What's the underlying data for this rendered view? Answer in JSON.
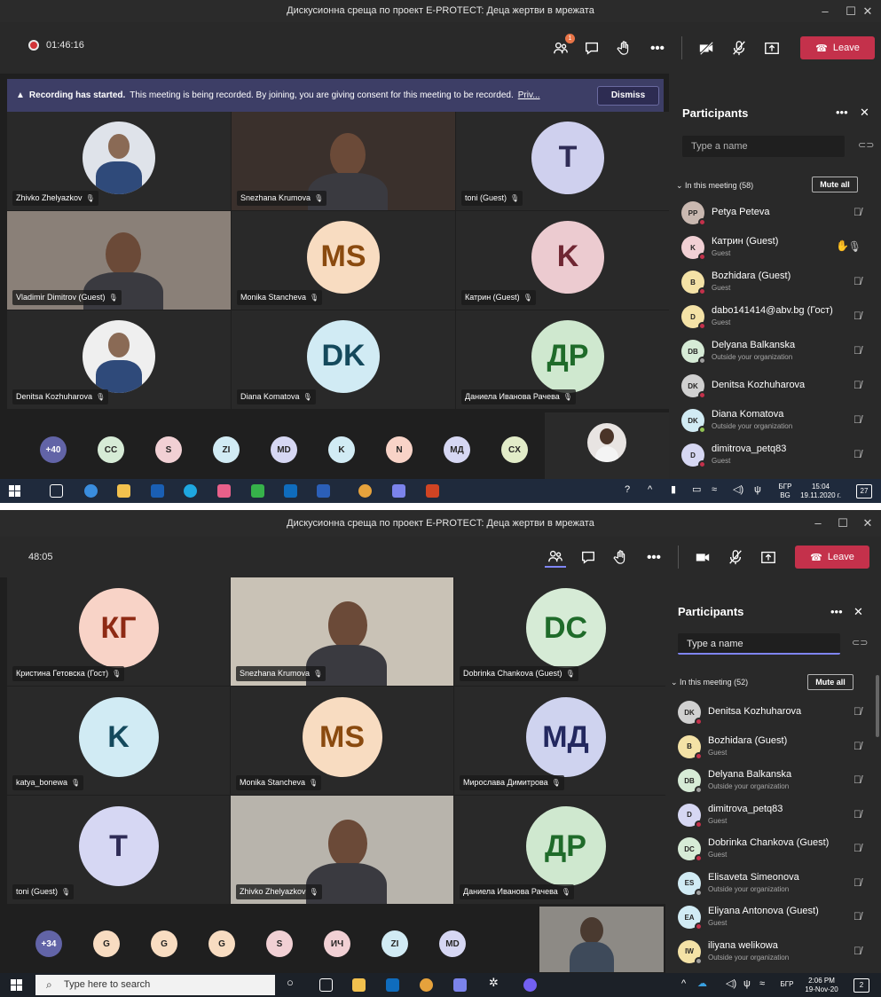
{
  "top": {
    "title": "Дискусионна среща по проект E-PROTECT: Деца жертви в мрежата",
    "timer": "01:46:16",
    "leave_label": "Leave",
    "participants_badge": "1",
    "banner": {
      "bold": "Recording has started.",
      "text": "This meeting is being recorded. By joining, you are giving consent for this meeting to be recorded.",
      "link": "Priv...",
      "dismiss": "Dismiss"
    },
    "tiles": [
      {
        "name": "Zhivko Zhelyazkov",
        "kind": "photo",
        "bg": "#dfe3ea"
      },
      {
        "name": "Snezhana Krumova",
        "kind": "video",
        "bg": "#3a302c"
      },
      {
        "name": "toni (Guest)",
        "initials": "T",
        "color": "#cfd0ee",
        "text": "#2f2c56"
      },
      {
        "name": "Vladimir Dimitrov (Guest)",
        "kind": "video",
        "bg": "#8a8078"
      },
      {
        "name": "Monika Stancheva",
        "initials": "MS",
        "color": "#f8dcc1",
        "text": "#8a4a0f"
      },
      {
        "name": "Катрин (Guest)",
        "initials": "K",
        "color": "#eccbd0",
        "text": "#6f2632"
      },
      {
        "name": "Denitsa Kozhuharova",
        "kind": "photo",
        "bg": "#efefef"
      },
      {
        "name": "Diana Komatova",
        "initials": "DK",
        "color": "#d1ebf4",
        "text": "#14495c"
      },
      {
        "name": "Даниела Иванова Рачева",
        "initials": "ДР",
        "color": "#cfe8cf",
        "text": "#1f6b2a"
      }
    ],
    "overflow": [
      {
        "label": "+40",
        "color": "#6264a7"
      },
      {
        "label": "CC",
        "color": "#d6ebd6"
      },
      {
        "label": "S",
        "color": "#f1d0d4"
      },
      {
        "label": "ZI",
        "color": "#d1ebf4"
      },
      {
        "label": "MD",
        "color": "#d6d7f3"
      },
      {
        "label": "K",
        "color": "#d1ebf4"
      },
      {
        "label": "N",
        "color": "#f8d3c7"
      },
      {
        "label": "МД",
        "color": "#d6d7f3"
      },
      {
        "label": "CX",
        "color": "#e2ecc8"
      }
    ],
    "panel": {
      "title": "Participants",
      "search_placeholder": "Type a name",
      "section": "In this meeting (58)",
      "mute_all": "Mute all",
      "people": [
        {
          "name": "Petya Peteva",
          "sub": "",
          "initials": "PP",
          "color": "#c9b8b0",
          "status": "#c4314b"
        },
        {
          "name": "Катрин (Guest)",
          "sub": "Guest",
          "initials": "K",
          "color": "#f1d0d4",
          "status": "#c4314b",
          "hand": true
        },
        {
          "name": "Bozhidara (Guest)",
          "sub": "Guest",
          "initials": "B",
          "color": "#f4e2a6",
          "status": "#c4314b"
        },
        {
          "name": "dabo141414@abv.bg (Гост)",
          "sub": "Guest",
          "initials": "D",
          "color": "#f4e2a6",
          "status": "#c4314b"
        },
        {
          "name": "Delyana Balkanska",
          "sub": "Outside your organization",
          "initials": "DB",
          "color": "#d6ebd6",
          "status": "#9e9e9e"
        },
        {
          "name": "Denitsa Kozhuharova",
          "sub": "",
          "initials": "DK",
          "color": "#d0d0d0",
          "status": "#c4314b"
        },
        {
          "name": "Diana Komatova",
          "sub": "Outside your organization",
          "initials": "DK",
          "color": "#d1ebf4",
          "status": "#92c353"
        },
        {
          "name": "dimitrova_petq83",
          "sub": "Guest",
          "initials": "D",
          "color": "#d6d7f3",
          "status": "#c4314b"
        }
      ]
    },
    "taskbar": {
      "lang1": "БГР",
      "lang2": "BG",
      "time": "15:04",
      "date": "19.11.2020 г.",
      "notif": "27"
    }
  },
  "bottom": {
    "title": "Дискусионна среща по проект E-PROTECT: Деца жертви в мрежата",
    "timer": "48:05",
    "leave_label": "Leave",
    "tiles": [
      {
        "name": "Кристина Гетовска (Гост)",
        "initials": "КГ",
        "color": "#f8d3c7",
        "text": "#8e2a14"
      },
      {
        "name": "Snezhana Krumova",
        "kind": "video",
        "bg": "#c9c2b6"
      },
      {
        "name": "Dobrinka Chankova (Guest)",
        "initials": "DC",
        "color": "#d6ebd6",
        "text": "#1f6b2a"
      },
      {
        "name": "katya_bonewa",
        "initials": "K",
        "color": "#d1ebf4",
        "text": "#14495c"
      },
      {
        "name": "Monika Stancheva",
        "initials": "MS",
        "color": "#f8dcc1",
        "text": "#8a4a0f"
      },
      {
        "name": "Мирослава Димитрова",
        "initials": "МД",
        "color": "#cfd3ef",
        "text": "#23285f"
      },
      {
        "name": "toni (Guest)",
        "initials": "T",
        "color": "#d6d7f3",
        "text": "#2f2c56"
      },
      {
        "name": "Zhivko Zhelyazkov",
        "kind": "video",
        "bg": "#b8b4ac"
      },
      {
        "name": "Даниела Иванова Рачева",
        "initials": "ДР",
        "color": "#cfe8cf",
        "text": "#1f6b2a"
      }
    ],
    "overflow": [
      {
        "label": "+34",
        "color": "#6264a7"
      },
      {
        "label": "G",
        "color": "#f8dcc1"
      },
      {
        "label": "G",
        "color": "#f8dcc1"
      },
      {
        "label": "G",
        "color": "#f8dcc1"
      },
      {
        "label": "S",
        "color": "#f1d0d4"
      },
      {
        "label": "ИЧ",
        "color": "#f1d0d4"
      },
      {
        "label": "ZI",
        "color": "#d1ebf4"
      },
      {
        "label": "MD",
        "color": "#d6d7f3"
      }
    ],
    "panel": {
      "title": "Participants",
      "search_placeholder": "Type a name",
      "section": "In this meeting (52)",
      "mute_all": "Mute all",
      "people": [
        {
          "name": "Denitsa Kozhuharova",
          "sub": "",
          "initials": "DK",
          "color": "#d0d0d0",
          "status": "#c4314b"
        },
        {
          "name": "Bozhidara (Guest)",
          "sub": "Guest",
          "initials": "B",
          "color": "#f4e2a6",
          "status": "#c4314b"
        },
        {
          "name": "Delyana Balkanska",
          "sub": "Outside your organization",
          "initials": "DB",
          "color": "#d6ebd6",
          "status": "#9e9e9e"
        },
        {
          "name": "dimitrova_petq83",
          "sub": "Guest",
          "initials": "D",
          "color": "#d6d7f3",
          "status": "#c4314b"
        },
        {
          "name": "Dobrinka Chankova (Guest)",
          "sub": "Guest",
          "initials": "DC",
          "color": "#d6ebd6",
          "status": "#c4314b"
        },
        {
          "name": "Elisaveta Simeonova",
          "sub": "Outside your organization",
          "initials": "ES",
          "color": "#d1ebf4",
          "status": "#9e9e9e"
        },
        {
          "name": "Eliyana Antonova (Guest)",
          "sub": "Guest",
          "initials": "EA",
          "color": "#d1ebf4",
          "status": "#c4314b"
        },
        {
          "name": "iliyana welikowa",
          "sub": "Outside your organization",
          "initials": "IW",
          "color": "#f4e2a6",
          "status": "#9e9e9e"
        }
      ]
    },
    "taskbar": {
      "search": "Type here to search",
      "lang": "БГР",
      "time": "2:06 PM",
      "date": "19-Nov-20",
      "notif": "2"
    }
  }
}
